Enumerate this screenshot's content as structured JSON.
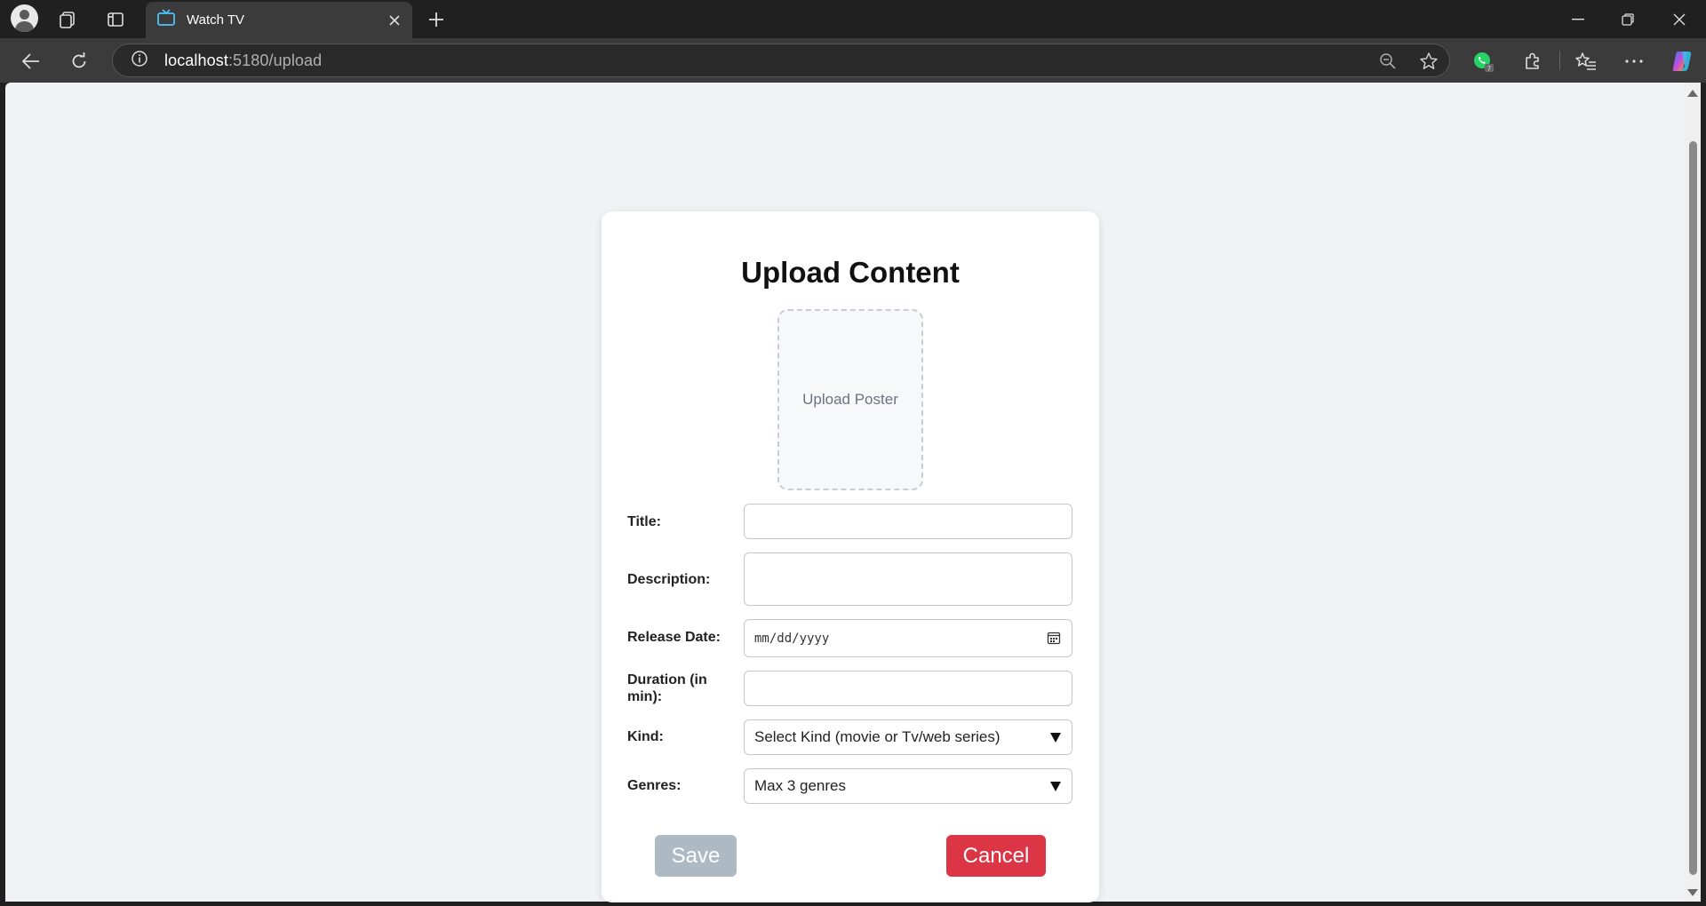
{
  "browser": {
    "tab_title": "Watch TV",
    "url_host": "localhost",
    "url_rest": ":5180/upload"
  },
  "form": {
    "heading": "Upload Content",
    "poster_label": "Upload Poster",
    "title_label": "Title:",
    "title_value": "",
    "description_label": "Description:",
    "description_value": "",
    "release_label": "Release Date:",
    "release_placeholder": "mm/dd/yyyy",
    "duration_label": "Duration (in min):",
    "duration_value": "",
    "kind_label": "Kind:",
    "kind_selected": "Select Kind (movie or Tv/web series)",
    "genres_label": "Genres:",
    "genres_selected": "Max 3 genres",
    "save_label": "Save",
    "cancel_label": "Cancel"
  },
  "colors": {
    "save_bg": "#adb9c3",
    "cancel_bg": "#dc3545",
    "page_bg": "#f0f2f5",
    "tab_icon": "#4fc3f7"
  }
}
